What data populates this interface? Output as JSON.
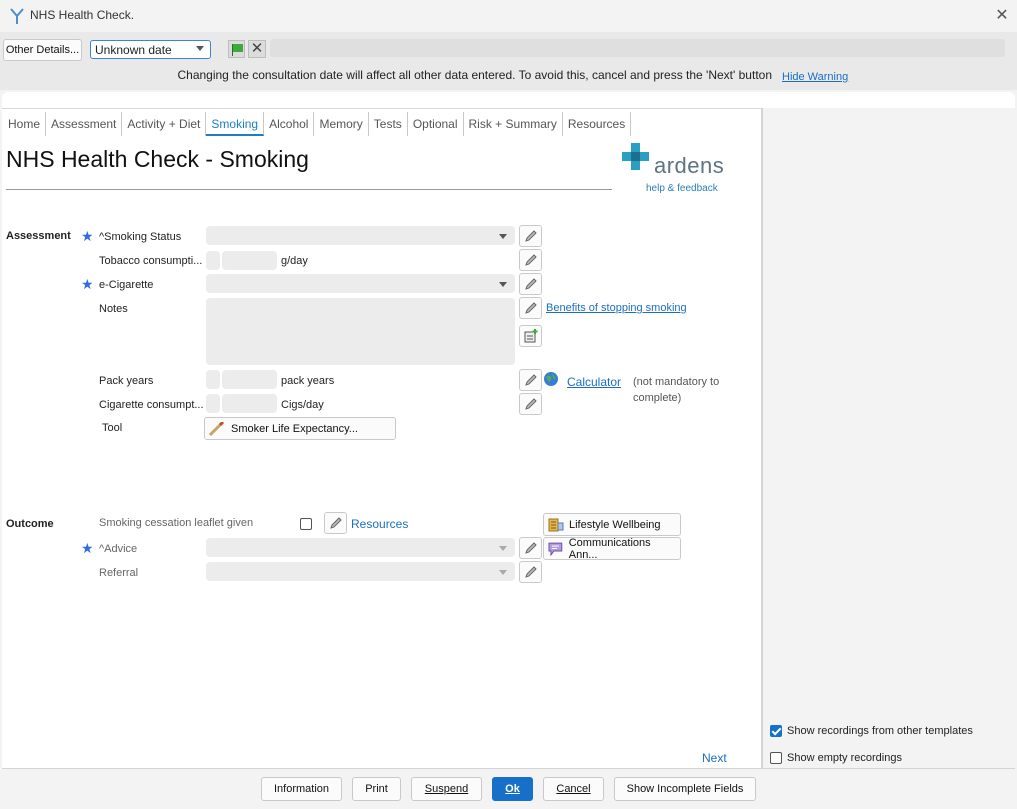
{
  "window": {
    "title": "NHS Health Check."
  },
  "toolbar": {
    "other_details_label": "Other Details...",
    "date_value": "Unknown date",
    "warning_text": "Changing the consultation date will affect all other data entered. To avoid this, cancel and press the 'Next' button",
    "hide_warning_label": "Hide Warning"
  },
  "tabs": [
    {
      "label": "Home"
    },
    {
      "label": "Assessment"
    },
    {
      "label": "Activity + Diet"
    },
    {
      "label": "Smoking",
      "active": true
    },
    {
      "label": "Alcohol"
    },
    {
      "label": "Memory"
    },
    {
      "label": "Tests"
    },
    {
      "label": "Optional"
    },
    {
      "label": "Risk + Summary"
    },
    {
      "label": "Resources"
    }
  ],
  "page": {
    "title": "NHS Health Check - Smoking",
    "logo_text": "ardens",
    "logo_sub": "help & feedback"
  },
  "assessment": {
    "section_label": "Assessment",
    "smoking_status_label": "^Smoking Status",
    "tobacco_label": "Tobacco consumpti...",
    "tobacco_unit": "g/day",
    "ecig_label": "e-Cigarette",
    "notes_label": "Notes",
    "benefits_link": "Benefits of stopping smoking",
    "pack_years_label": "Pack years",
    "pack_years_unit": "pack years",
    "calculator_link": "Calculator",
    "not_mandatory_line1": "(not mandatory to",
    "not_mandatory_line2": "complete)",
    "cig_label": "Cigarette consumpt...",
    "cig_unit": "Cigs/day",
    "tool_label": "Tool",
    "tool_button": "Smoker Life Expectancy..."
  },
  "outcome": {
    "section_label": "Outcome",
    "leaflet_label": "Smoking cessation leaflet given",
    "resources_link": "Resources",
    "lifestyle_button": "Lifestyle Wellbeing",
    "advice_label": "^Advice",
    "communications_button": "Communications Ann...",
    "referral_label": "Referral"
  },
  "nav": {
    "next_label": "Next"
  },
  "right_panel": {
    "show_other_templates": "Show recordings from other templates",
    "show_other_templates_checked": true,
    "show_empty": "Show empty recordings",
    "show_empty_checked": false
  },
  "footer": {
    "information": "Information",
    "print": "Print",
    "suspend": "Suspend",
    "ok": "Ok",
    "cancel": "Cancel",
    "show_incomplete": "Show Incomplete Fields"
  },
  "colors": {
    "accent": "#1670c9",
    "link": "#1b6ec2",
    "star": "#2f6de0",
    "logo": "#2a9fc4"
  }
}
